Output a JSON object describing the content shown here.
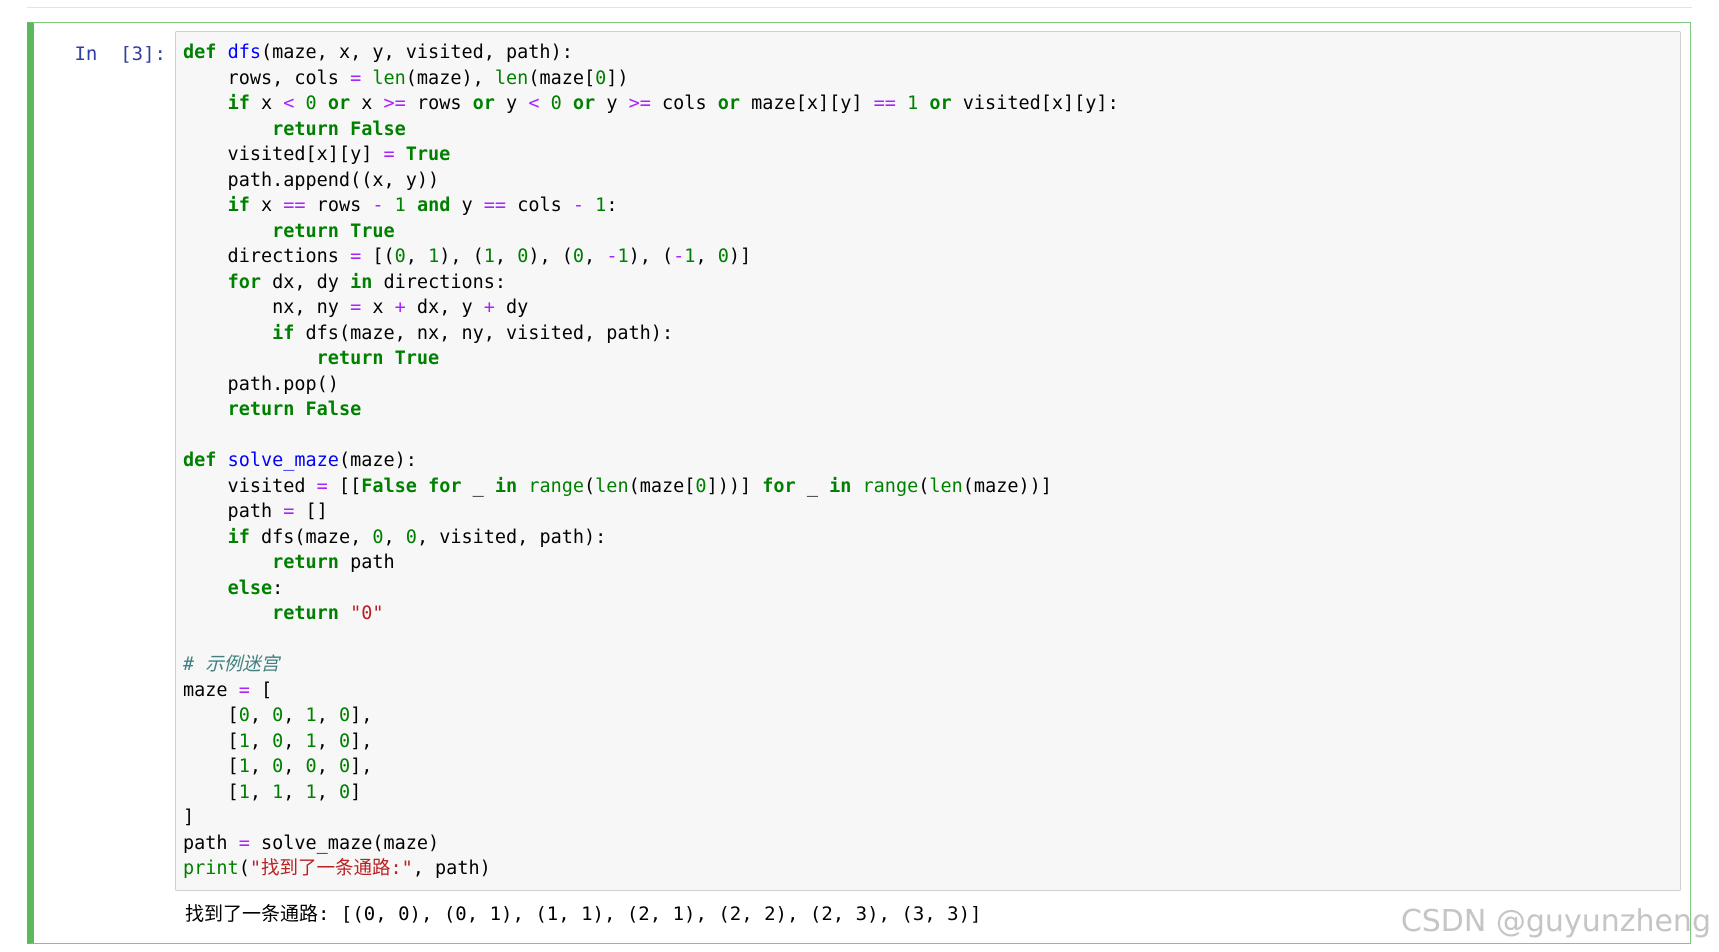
{
  "cell": {
    "prompt": "In  [3]:",
    "code_lines": [
      [
        {
          "t": "def",
          "c": "kw"
        },
        {
          "t": " "
        },
        {
          "t": "dfs",
          "c": "fn"
        },
        {
          "t": "(maze, x, y, visited, path):"
        }
      ],
      [
        {
          "t": "    rows, cols "
        },
        {
          "t": "=",
          "c": "op"
        },
        {
          "t": " "
        },
        {
          "t": "len",
          "c": "bi"
        },
        {
          "t": "(maze), "
        },
        {
          "t": "len",
          "c": "bi"
        },
        {
          "t": "(maze["
        },
        {
          "t": "0",
          "c": "nm"
        },
        {
          "t": "])"
        }
      ],
      [
        {
          "t": "    "
        },
        {
          "t": "if",
          "c": "kw"
        },
        {
          "t": " x "
        },
        {
          "t": "<",
          "c": "op"
        },
        {
          "t": " "
        },
        {
          "t": "0",
          "c": "nm"
        },
        {
          "t": " "
        },
        {
          "t": "or",
          "c": "kw"
        },
        {
          "t": " x "
        },
        {
          "t": ">=",
          "c": "op"
        },
        {
          "t": " rows "
        },
        {
          "t": "or",
          "c": "kw"
        },
        {
          "t": " y "
        },
        {
          "t": "<",
          "c": "op"
        },
        {
          "t": " "
        },
        {
          "t": "0",
          "c": "nm"
        },
        {
          "t": " "
        },
        {
          "t": "or",
          "c": "kw"
        },
        {
          "t": " y "
        },
        {
          "t": ">=",
          "c": "op"
        },
        {
          "t": " cols "
        },
        {
          "t": "or",
          "c": "kw"
        },
        {
          "t": " maze[x][y] "
        },
        {
          "t": "==",
          "c": "op"
        },
        {
          "t": " "
        },
        {
          "t": "1",
          "c": "nm"
        },
        {
          "t": " "
        },
        {
          "t": "or",
          "c": "kw"
        },
        {
          "t": " visited[x][y]:"
        }
      ],
      [
        {
          "t": "        "
        },
        {
          "t": "return",
          "c": "kw"
        },
        {
          "t": " "
        },
        {
          "t": "False",
          "c": "kw"
        }
      ],
      [
        {
          "t": "    visited[x][y] "
        },
        {
          "t": "=",
          "c": "op"
        },
        {
          "t": " "
        },
        {
          "t": "True",
          "c": "kw"
        }
      ],
      [
        {
          "t": "    path.append((x, y))"
        }
      ],
      [
        {
          "t": "    "
        },
        {
          "t": "if",
          "c": "kw"
        },
        {
          "t": " x "
        },
        {
          "t": "==",
          "c": "op"
        },
        {
          "t": " rows "
        },
        {
          "t": "-",
          "c": "op"
        },
        {
          "t": " "
        },
        {
          "t": "1",
          "c": "nm"
        },
        {
          "t": " "
        },
        {
          "t": "and",
          "c": "kw"
        },
        {
          "t": " y "
        },
        {
          "t": "==",
          "c": "op"
        },
        {
          "t": " cols "
        },
        {
          "t": "-",
          "c": "op"
        },
        {
          "t": " "
        },
        {
          "t": "1",
          "c": "nm"
        },
        {
          "t": ":"
        }
      ],
      [
        {
          "t": "        "
        },
        {
          "t": "return",
          "c": "kw"
        },
        {
          "t": " "
        },
        {
          "t": "True",
          "c": "kw"
        }
      ],
      [
        {
          "t": "    directions "
        },
        {
          "t": "=",
          "c": "op"
        },
        {
          "t": " [("
        },
        {
          "t": "0",
          "c": "nm"
        },
        {
          "t": ", "
        },
        {
          "t": "1",
          "c": "nm"
        },
        {
          "t": "), ("
        },
        {
          "t": "1",
          "c": "nm"
        },
        {
          "t": ", "
        },
        {
          "t": "0",
          "c": "nm"
        },
        {
          "t": "), ("
        },
        {
          "t": "0",
          "c": "nm"
        },
        {
          "t": ", "
        },
        {
          "t": "-",
          "c": "op"
        },
        {
          "t": "1",
          "c": "nm"
        },
        {
          "t": "), ("
        },
        {
          "t": "-",
          "c": "op"
        },
        {
          "t": "1",
          "c": "nm"
        },
        {
          "t": ", "
        },
        {
          "t": "0",
          "c": "nm"
        },
        {
          "t": ")]"
        }
      ],
      [
        {
          "t": "    "
        },
        {
          "t": "for",
          "c": "kw"
        },
        {
          "t": " dx, dy "
        },
        {
          "t": "in",
          "c": "kw"
        },
        {
          "t": " directions:"
        }
      ],
      [
        {
          "t": "        nx, ny "
        },
        {
          "t": "=",
          "c": "op"
        },
        {
          "t": " x "
        },
        {
          "t": "+",
          "c": "op"
        },
        {
          "t": " dx, y "
        },
        {
          "t": "+",
          "c": "op"
        },
        {
          "t": " dy"
        }
      ],
      [
        {
          "t": "        "
        },
        {
          "t": "if",
          "c": "kw"
        },
        {
          "t": " dfs(maze, nx, ny, visited, path):"
        }
      ],
      [
        {
          "t": "            "
        },
        {
          "t": "return",
          "c": "kw"
        },
        {
          "t": " "
        },
        {
          "t": "True",
          "c": "kw"
        }
      ],
      [
        {
          "t": "    path.pop()"
        }
      ],
      [
        {
          "t": "    "
        },
        {
          "t": "return",
          "c": "kw"
        },
        {
          "t": " "
        },
        {
          "t": "False",
          "c": "kw"
        }
      ],
      [
        {
          "t": ""
        }
      ],
      [
        {
          "t": "def",
          "c": "kw"
        },
        {
          "t": " "
        },
        {
          "t": "solve_maze",
          "c": "fn"
        },
        {
          "t": "(maze):"
        }
      ],
      [
        {
          "t": "    visited "
        },
        {
          "t": "=",
          "c": "op"
        },
        {
          "t": " [["
        },
        {
          "t": "False",
          "c": "kw"
        },
        {
          "t": " "
        },
        {
          "t": "for",
          "c": "kw"
        },
        {
          "t": " _ "
        },
        {
          "t": "in",
          "c": "kw"
        },
        {
          "t": " "
        },
        {
          "t": "range",
          "c": "bi"
        },
        {
          "t": "("
        },
        {
          "t": "len",
          "c": "bi"
        },
        {
          "t": "(maze["
        },
        {
          "t": "0",
          "c": "nm"
        },
        {
          "t": "]))] "
        },
        {
          "t": "for",
          "c": "kw"
        },
        {
          "t": " _ "
        },
        {
          "t": "in",
          "c": "kw"
        },
        {
          "t": " "
        },
        {
          "t": "range",
          "c": "bi"
        },
        {
          "t": "("
        },
        {
          "t": "len",
          "c": "bi"
        },
        {
          "t": "(maze))]"
        }
      ],
      [
        {
          "t": "    path "
        },
        {
          "t": "=",
          "c": "op"
        },
        {
          "t": " []"
        }
      ],
      [
        {
          "t": "    "
        },
        {
          "t": "if",
          "c": "kw"
        },
        {
          "t": " dfs(maze, "
        },
        {
          "t": "0",
          "c": "nm"
        },
        {
          "t": ", "
        },
        {
          "t": "0",
          "c": "nm"
        },
        {
          "t": ", visited, path):"
        }
      ],
      [
        {
          "t": "        "
        },
        {
          "t": "return",
          "c": "kw"
        },
        {
          "t": " path"
        }
      ],
      [
        {
          "t": "    "
        },
        {
          "t": "else",
          "c": "kw"
        },
        {
          "t": ":"
        }
      ],
      [
        {
          "t": "        "
        },
        {
          "t": "return",
          "c": "kw"
        },
        {
          "t": " "
        },
        {
          "t": "\"0\"",
          "c": "st"
        }
      ],
      [
        {
          "t": ""
        }
      ],
      [
        {
          "t": "# 示例迷宫",
          "c": "cm"
        }
      ],
      [
        {
          "t": "maze "
        },
        {
          "t": "=",
          "c": "op"
        },
        {
          "t": " ["
        }
      ],
      [
        {
          "t": "    ["
        },
        {
          "t": "0",
          "c": "nm"
        },
        {
          "t": ", "
        },
        {
          "t": "0",
          "c": "nm"
        },
        {
          "t": ", "
        },
        {
          "t": "1",
          "c": "nm"
        },
        {
          "t": ", "
        },
        {
          "t": "0",
          "c": "nm"
        },
        {
          "t": "],"
        }
      ],
      [
        {
          "t": "    ["
        },
        {
          "t": "1",
          "c": "nm"
        },
        {
          "t": ", "
        },
        {
          "t": "0",
          "c": "nm"
        },
        {
          "t": ", "
        },
        {
          "t": "1",
          "c": "nm"
        },
        {
          "t": ", "
        },
        {
          "t": "0",
          "c": "nm"
        },
        {
          "t": "],"
        }
      ],
      [
        {
          "t": "    ["
        },
        {
          "t": "1",
          "c": "nm"
        },
        {
          "t": ", "
        },
        {
          "t": "0",
          "c": "nm"
        },
        {
          "t": ", "
        },
        {
          "t": "0",
          "c": "nm"
        },
        {
          "t": ", "
        },
        {
          "t": "0",
          "c": "nm"
        },
        {
          "t": "],"
        }
      ],
      [
        {
          "t": "    ["
        },
        {
          "t": "1",
          "c": "nm"
        },
        {
          "t": ", "
        },
        {
          "t": "1",
          "c": "nm"
        },
        {
          "t": ", "
        },
        {
          "t": "1",
          "c": "nm"
        },
        {
          "t": ", "
        },
        {
          "t": "0",
          "c": "nm"
        },
        {
          "t": "]"
        }
      ],
      [
        {
          "t": "]"
        }
      ],
      [
        {
          "t": "path "
        },
        {
          "t": "=",
          "c": "op"
        },
        {
          "t": " solve_maze(maze)"
        }
      ],
      [
        {
          "t": "print",
          "c": "bi"
        },
        {
          "t": "("
        },
        {
          "t": "\"找到了一条通路:\"",
          "c": "st"
        },
        {
          "t": ", path)"
        }
      ]
    ],
    "output": "找到了一条通路: [(0, 0), (0, 1), (1, 1), (2, 1), (2, 2), (2, 3), (3, 3)]"
  },
  "watermark": "CSDN @guyunzheng"
}
